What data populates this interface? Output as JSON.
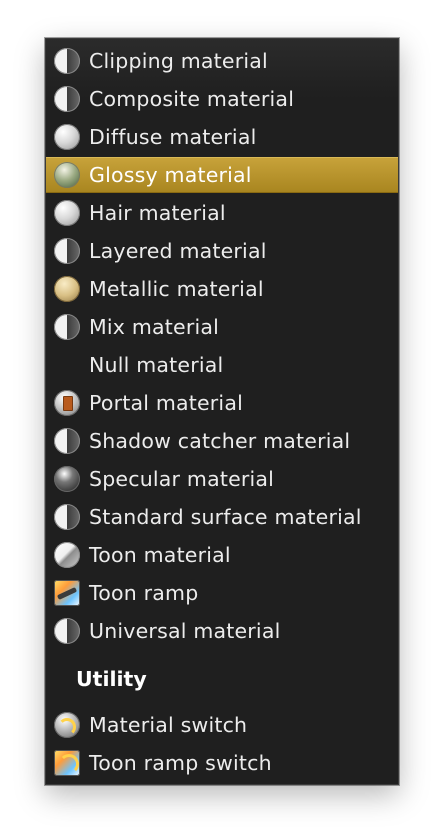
{
  "menu": {
    "items": [
      {
        "label": "Clipping material",
        "icon": "clipping-material-icon"
      },
      {
        "label": "Composite material",
        "icon": "composite-material-icon"
      },
      {
        "label": "Diffuse material",
        "icon": "diffuse-material-icon"
      },
      {
        "label": "Glossy material",
        "icon": "glossy-material-icon",
        "selected": true
      },
      {
        "label": "Hair material",
        "icon": "hair-material-icon"
      },
      {
        "label": "Layered material",
        "icon": "layered-material-icon"
      },
      {
        "label": "Metallic material",
        "icon": "metallic-material-icon"
      },
      {
        "label": "Mix material",
        "icon": "mix-material-icon"
      },
      {
        "label": "Null material",
        "icon": ""
      },
      {
        "label": "Portal material",
        "icon": "portal-material-icon"
      },
      {
        "label": "Shadow catcher material",
        "icon": "shadow-catcher-material-icon"
      },
      {
        "label": "Specular material",
        "icon": "specular-material-icon"
      },
      {
        "label": "Standard surface material",
        "icon": "standard-surface-material-icon"
      },
      {
        "label": "Toon material",
        "icon": "toon-material-icon"
      },
      {
        "label": "Toon ramp",
        "icon": "toon-ramp-icon"
      },
      {
        "label": "Universal material",
        "icon": "universal-material-icon"
      }
    ],
    "utility": {
      "header": "Utility",
      "items": [
        {
          "label": "Material switch",
          "icon": "material-switch-icon"
        },
        {
          "label": "Toon ramp switch",
          "icon": "toon-ramp-switch-icon"
        }
      ]
    }
  },
  "colors": {
    "background": "#1f1f1f",
    "selected": "#b8942f",
    "text": "#ececec"
  }
}
